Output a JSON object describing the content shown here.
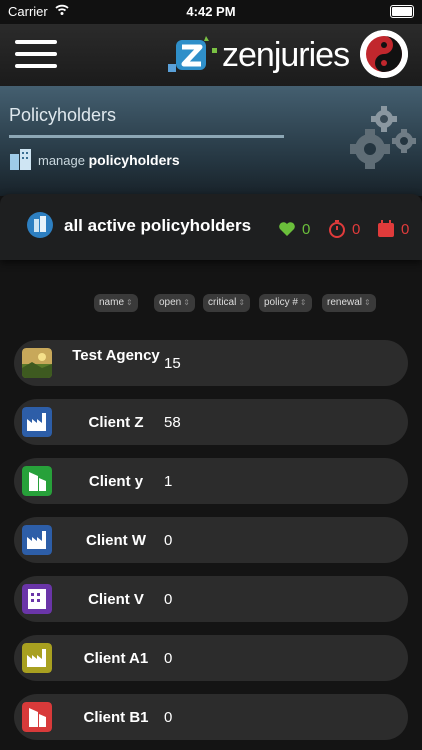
{
  "status": {
    "carrier": "Carrier",
    "time": "4:42 PM"
  },
  "header": {
    "brand": "zenjuries"
  },
  "hero": {
    "title": "Policyholders",
    "sub_prefix": "manage",
    "sub_bold": "policyholders"
  },
  "summary": {
    "label": "all active policyholders",
    "stats": [
      {
        "icon": "heart-icon",
        "value": "0",
        "color": "#6bbf3b"
      },
      {
        "icon": "stopwatch-icon",
        "value": "0",
        "color": "#e03b3b"
      },
      {
        "icon": "calendar-icon",
        "value": "0",
        "color": "#e03b3b"
      }
    ]
  },
  "sort": [
    "name",
    "open",
    "critical",
    "policy #",
    "renewal"
  ],
  "rows": [
    {
      "name": "Test Agency",
      "count": "15",
      "avatar": "photo",
      "color": "#7a8a3a"
    },
    {
      "name": "Client Z",
      "count": "58",
      "avatar": "factory",
      "color": "#2d5ea8"
    },
    {
      "name": "Client y",
      "count": "1",
      "avatar": "building",
      "color": "#27a13a"
    },
    {
      "name": "Client W",
      "count": "0",
      "avatar": "factory",
      "color": "#2d5ea8"
    },
    {
      "name": "Client V",
      "count": "0",
      "avatar": "building",
      "color": "#6a35a8"
    },
    {
      "name": "Client A1",
      "count": "0",
      "avatar": "factory",
      "color": "#a8a020"
    },
    {
      "name": "Client B1",
      "count": "0",
      "avatar": "building",
      "color": "#d83a3a"
    }
  ]
}
